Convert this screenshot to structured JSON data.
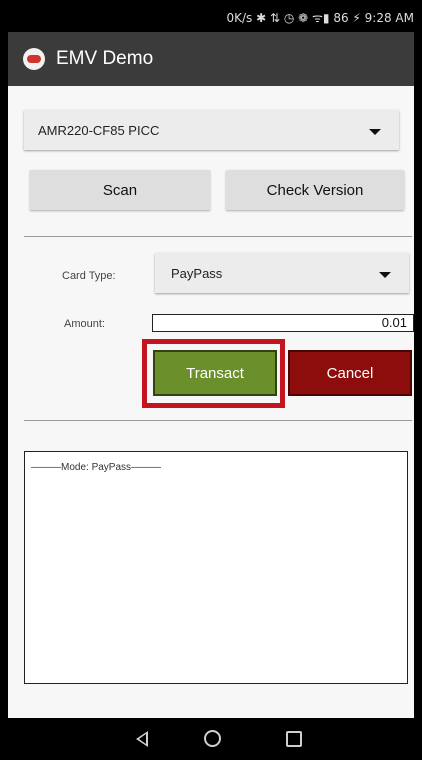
{
  "status_bar": {
    "text": "0K/s ✱ ⇅ ◷ ❁ ᯤ▮ 86 ⚡ 9:28 AM"
  },
  "app_bar": {
    "title": "EMV Demo"
  },
  "reader_select": {
    "value": "AMR220-CF85 PICC"
  },
  "buttons": {
    "scan": "Scan",
    "check_version": "Check Version",
    "transact": "Transact",
    "cancel": "Cancel"
  },
  "card_type": {
    "label": "Card Type:",
    "value": "PayPass"
  },
  "amount": {
    "label": "Amount:",
    "value": "0.01"
  },
  "log": {
    "mode_text": "———Mode: PayPass———"
  },
  "colors": {
    "transact_green": "#6b8f2a",
    "cancel_red": "#8d0c0c",
    "highlight_red": "#c4141f",
    "app_bar": "#3b3b3b"
  },
  "nav_bar": {
    "back_icon": "back-icon",
    "home_icon": "home-icon",
    "recents_icon": "recents-icon"
  }
}
